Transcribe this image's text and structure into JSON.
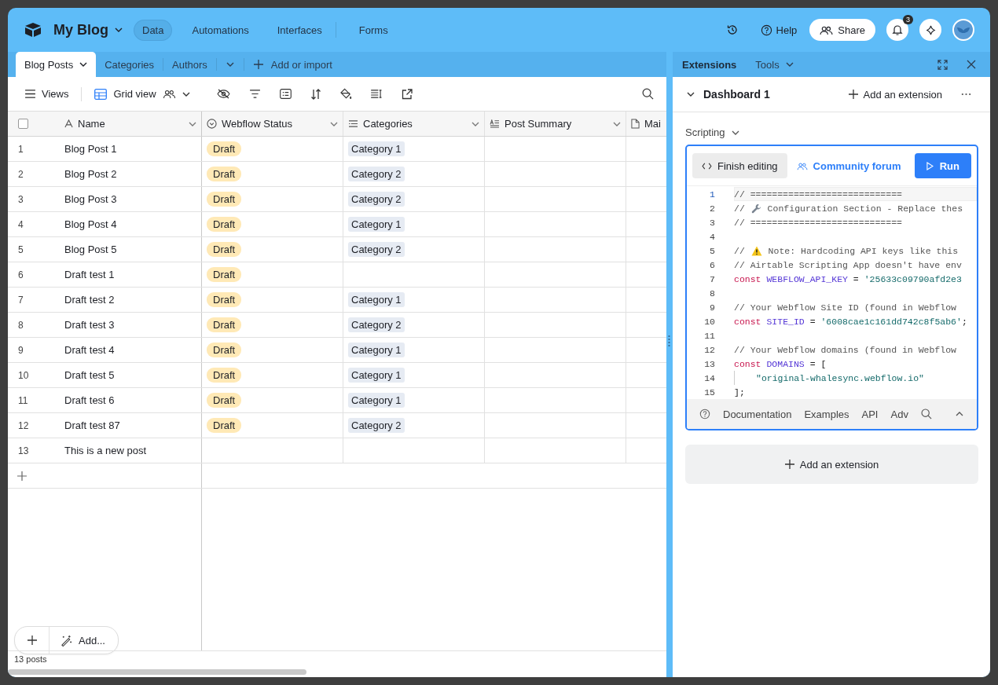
{
  "app": {
    "title": "My Blog",
    "nav": [
      {
        "label": "Data",
        "selected": true
      },
      {
        "label": "Automations",
        "selected": false
      },
      {
        "label": "Interfaces",
        "selected": false
      },
      {
        "label": "Forms",
        "selected": false
      }
    ],
    "help": "Help",
    "share": "Share",
    "notifications": "3"
  },
  "tables": [
    {
      "label": "Blog Posts",
      "selected": true
    },
    {
      "label": "Categories",
      "selected": false
    },
    {
      "label": "Authors",
      "selected": false
    }
  ],
  "add_table": "Add or import",
  "toolbar": {
    "views": "Views",
    "view_name": "Grid view"
  },
  "grid": {
    "columns": [
      {
        "label": "Name",
        "kind": "text"
      },
      {
        "label": "Webflow Status",
        "kind": "select"
      },
      {
        "label": "Categories",
        "kind": "link"
      },
      {
        "label": "Post Summary",
        "kind": "longtext"
      },
      {
        "label": "Mai",
        "kind": "file"
      }
    ],
    "rows": [
      {
        "number": "1",
        "name": "Blog Post 1",
        "status": "Draft",
        "category": "Category 1"
      },
      {
        "number": "2",
        "name": "Blog Post 2",
        "status": "Draft",
        "category": "Category 2"
      },
      {
        "number": "3",
        "name": "Blog Post 3",
        "status": "Draft",
        "category": "Category 2"
      },
      {
        "number": "4",
        "name": "Blog Post 4",
        "status": "Draft",
        "category": "Category 1"
      },
      {
        "number": "5",
        "name": "Blog Post 5",
        "status": "Draft",
        "category": "Category 2"
      },
      {
        "number": "6",
        "name": "Draft test 1",
        "status": "Draft"
      },
      {
        "number": "7",
        "name": "Draft test 2",
        "status": "Draft",
        "category": "Category 1"
      },
      {
        "number": "8",
        "name": "Draft test 3",
        "status": "Draft",
        "category": "Category 2"
      },
      {
        "number": "9",
        "name": "Draft test 4",
        "status": "Draft",
        "category": "Category 1"
      },
      {
        "number": "10",
        "name": "Draft test 5",
        "status": "Draft",
        "category": "Category 1"
      },
      {
        "number": "11",
        "name": "Draft test 6",
        "status": "Draft",
        "category": "Category 1"
      },
      {
        "number": "12",
        "name": "Draft test 87",
        "status": "Draft",
        "category": "Category 2"
      },
      {
        "number": "13",
        "name": "This is a new post"
      }
    ],
    "select_all_checked": false,
    "add_label": "Add...",
    "count": "13 posts"
  },
  "extensions": {
    "tabs": [
      {
        "label": "Extensions",
        "selected": true
      },
      {
        "label": "Tools",
        "selected": false
      }
    ],
    "dashboard": "Dashboard 1",
    "add": "Add an extension",
    "app_name": "Scripting",
    "finish": "Finish editing",
    "forum": "Community forum",
    "run": "Run",
    "code": [
      {
        "number": "1",
        "active": true,
        "segments": [
          {
            "kind": "comment",
            "text": "// ============================"
          }
        ]
      },
      {
        "number": "2",
        "active": false,
        "segments": [
          {
            "kind": "comment",
            "text": "// "
          },
          {
            "kind": "wrench"
          },
          {
            "kind": "comment",
            "text": " Configuration Section - Replace thes"
          }
        ]
      },
      {
        "number": "3",
        "active": false,
        "segments": [
          {
            "kind": "comment",
            "text": "// ============================"
          }
        ]
      },
      {
        "number": "4",
        "active": false
      },
      {
        "number": "5",
        "active": false,
        "segments": [
          {
            "kind": "comment",
            "text": "// "
          },
          {
            "kind": "warning"
          },
          {
            "kind": "comment",
            "text": " Note: Hardcoding API keys like this"
          }
        ]
      },
      {
        "number": "6",
        "active": false,
        "segments": [
          {
            "kind": "comment",
            "text": "// Airtable Scripting App doesn't have env"
          }
        ]
      },
      {
        "number": "7",
        "active": false,
        "segments": [
          {
            "kind": "keyword",
            "text": "const "
          },
          {
            "kind": "variable",
            "text": "WEBFLOW_API_KEY"
          },
          {
            "kind": "plain",
            "text": " = "
          },
          {
            "kind": "string",
            "text": "'25633c09790afd2e3"
          }
        ]
      },
      {
        "number": "8",
        "active": false
      },
      {
        "number": "9",
        "active": false,
        "segments": [
          {
            "kind": "comment",
            "text": "// Your Webflow Site ID (found in Webflow"
          }
        ]
      },
      {
        "number": "10",
        "active": false,
        "segments": [
          {
            "kind": "keyword",
            "text": "const "
          },
          {
            "kind": "variable",
            "text": "SITE_ID"
          },
          {
            "kind": "plain",
            "text": " = "
          },
          {
            "kind": "string",
            "text": "'6008cae1c161dd742c8f5ab6'"
          },
          {
            "kind": "plain",
            "text": ";"
          }
        ]
      },
      {
        "number": "11",
        "active": false
      },
      {
        "number": "12",
        "active": false,
        "segments": [
          {
            "kind": "comment",
            "text": "// Your Webflow domains (found in Webflow"
          }
        ]
      },
      {
        "number": "13",
        "active": false,
        "segments": [
          {
            "kind": "keyword",
            "text": "const "
          },
          {
            "kind": "variable",
            "text": "DOMAINS"
          },
          {
            "kind": "plain",
            "text": " = ["
          }
        ]
      },
      {
        "number": "14",
        "active": false,
        "segments": [
          {
            "kind": "indent"
          },
          {
            "kind": "string",
            "text": "\"original-whalesync.webflow.io\""
          }
        ]
      },
      {
        "number": "15",
        "active": false,
        "segments": [
          {
            "kind": "plain",
            "text": "];"
          }
        ]
      }
    ],
    "footer_links": [
      "Documentation",
      "Examples",
      "API",
      "Adv"
    ],
    "add_bottom": "Add an extension"
  }
}
